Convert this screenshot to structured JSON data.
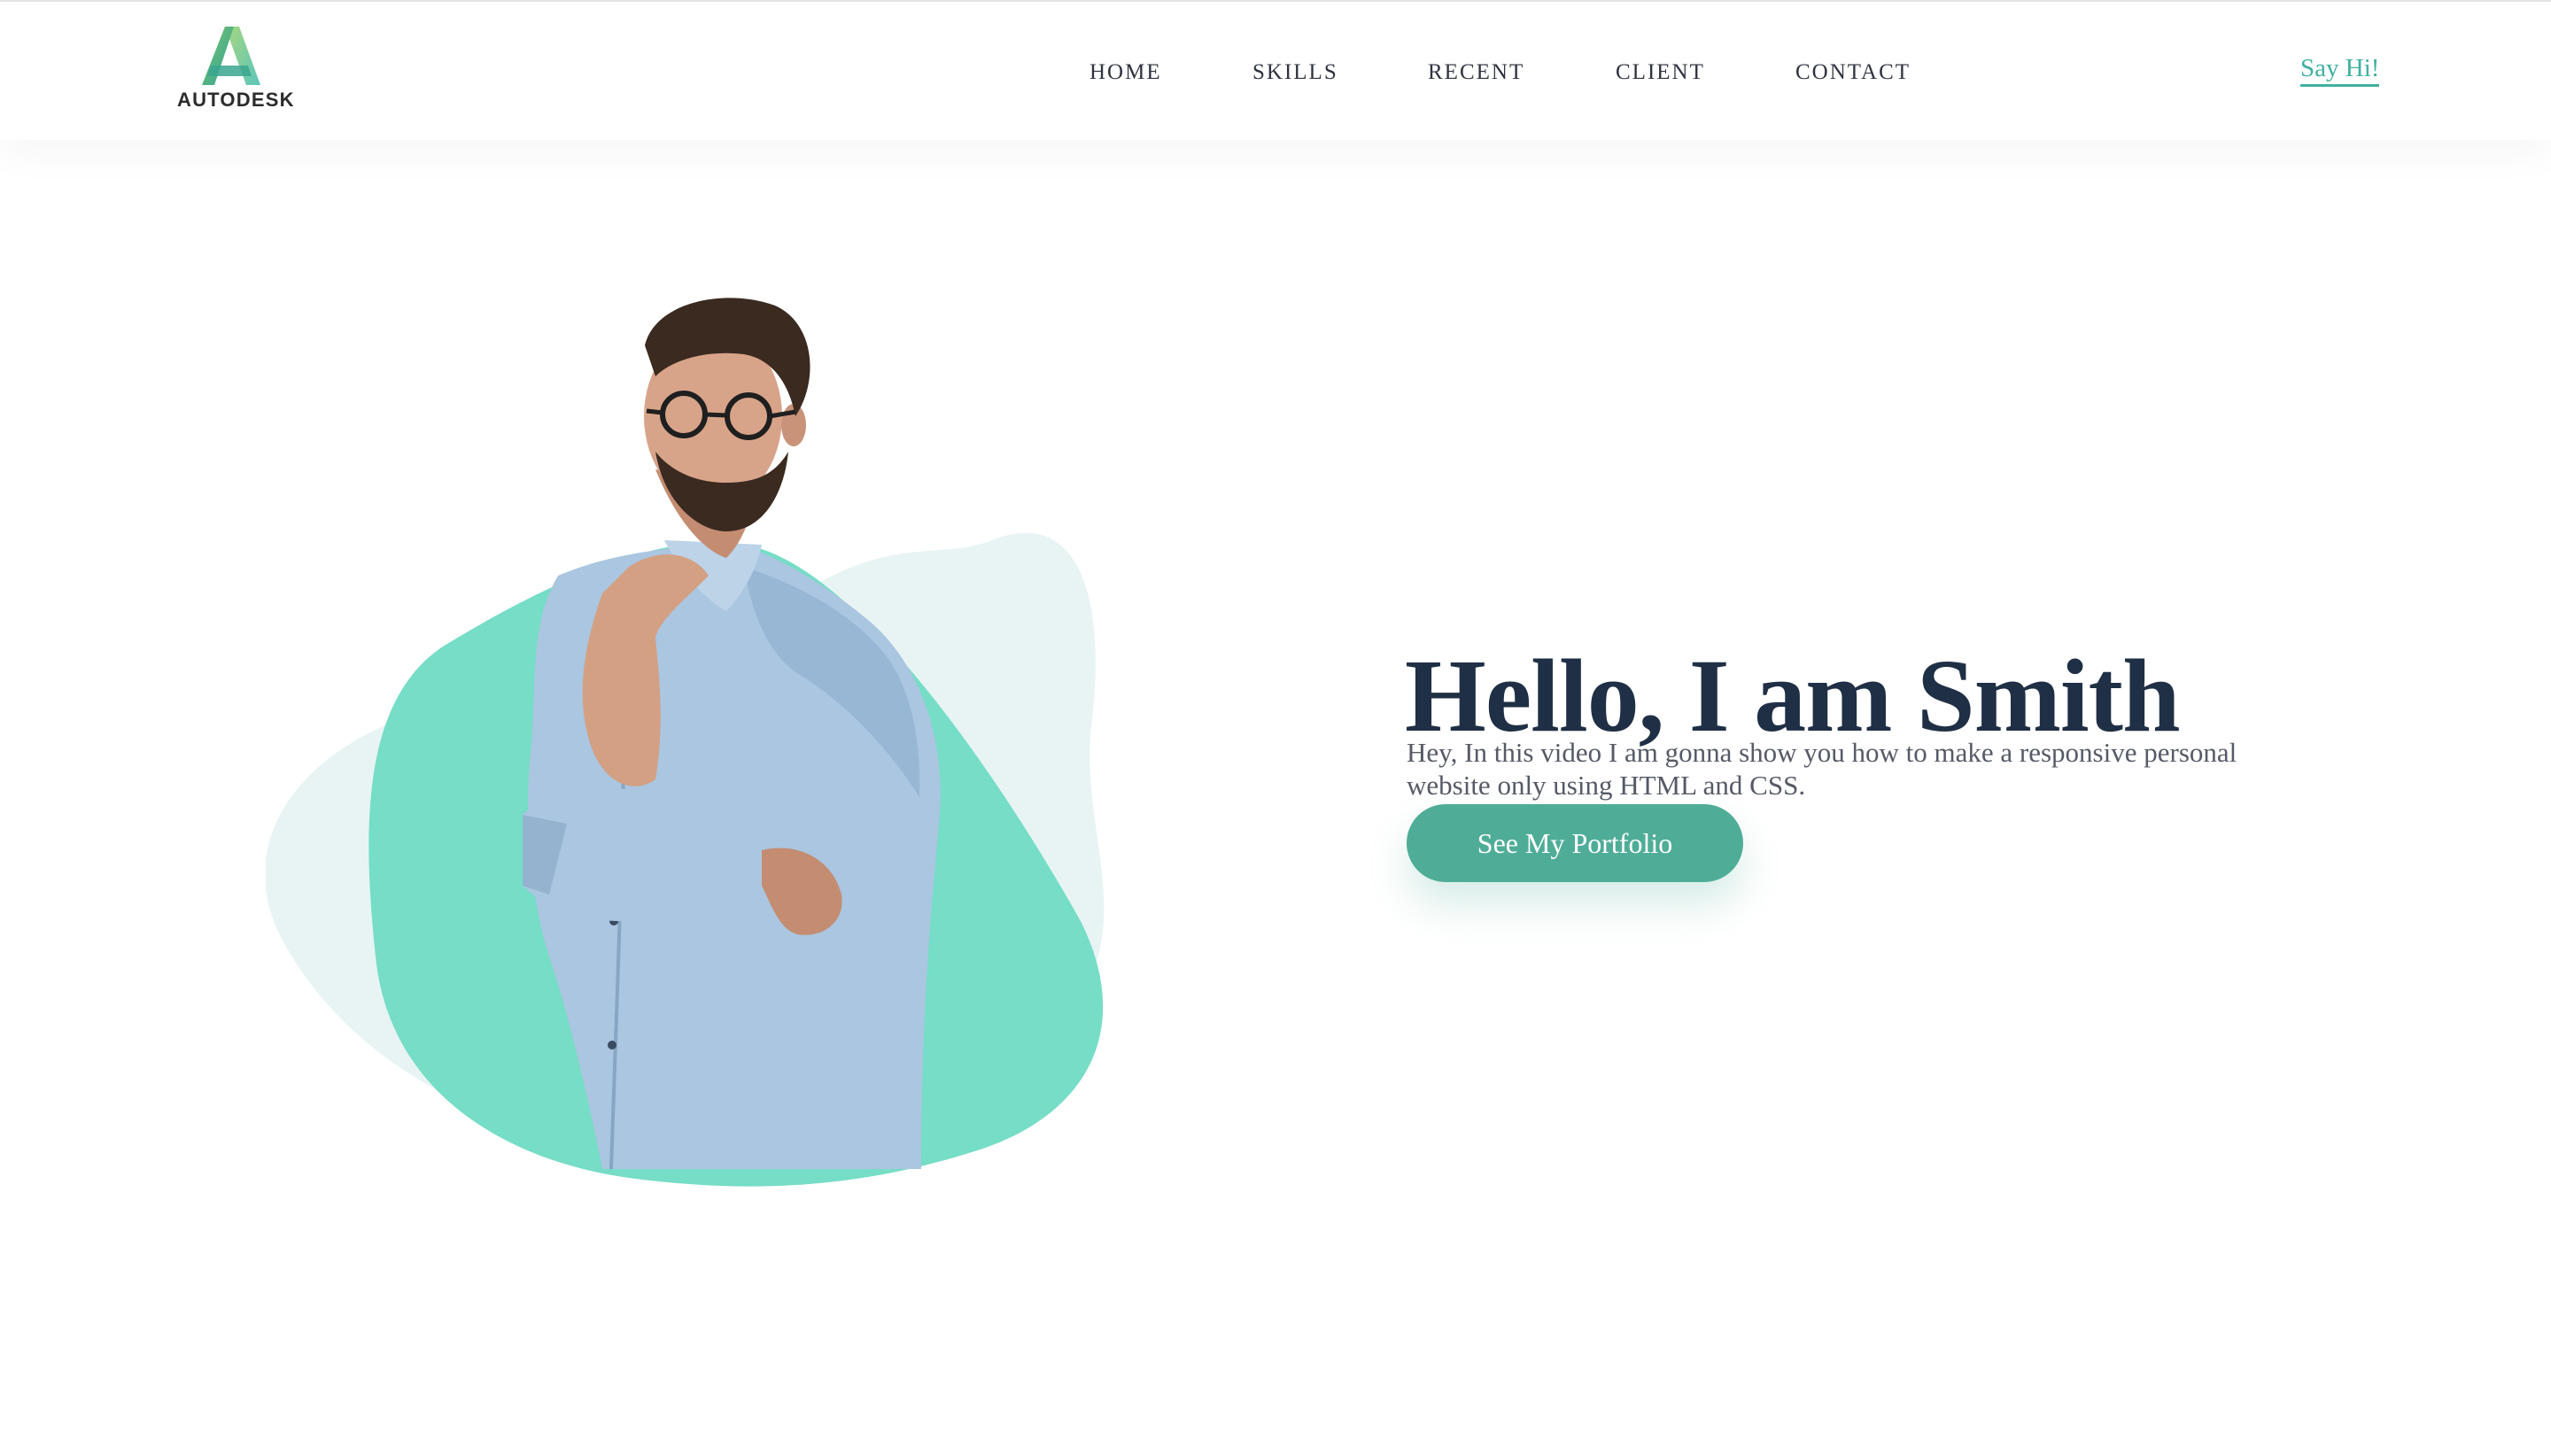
{
  "brand": {
    "logo_text": "AUTODESK",
    "icon": "autodesk-logo-icon"
  },
  "nav": {
    "items": [
      {
        "label": "HOME"
      },
      {
        "label": "SKILLS"
      },
      {
        "label": "RECENT"
      },
      {
        "label": "CLIENT"
      },
      {
        "label": "CONTACT"
      }
    ],
    "say_hi": "Say Hi!"
  },
  "hero": {
    "title": "Hello, I am Smith",
    "description": "Hey, In this video I am gonna show you how to make a responsive personal website only using HTML and CSS.",
    "button_label": "See My Portfolio"
  },
  "colors": {
    "accent": "#4fad97",
    "link": "#3fb0a0",
    "heading": "#1f2f45",
    "blob_primary": "#76ddc6",
    "blob_secondary": "#e8f4f3"
  }
}
